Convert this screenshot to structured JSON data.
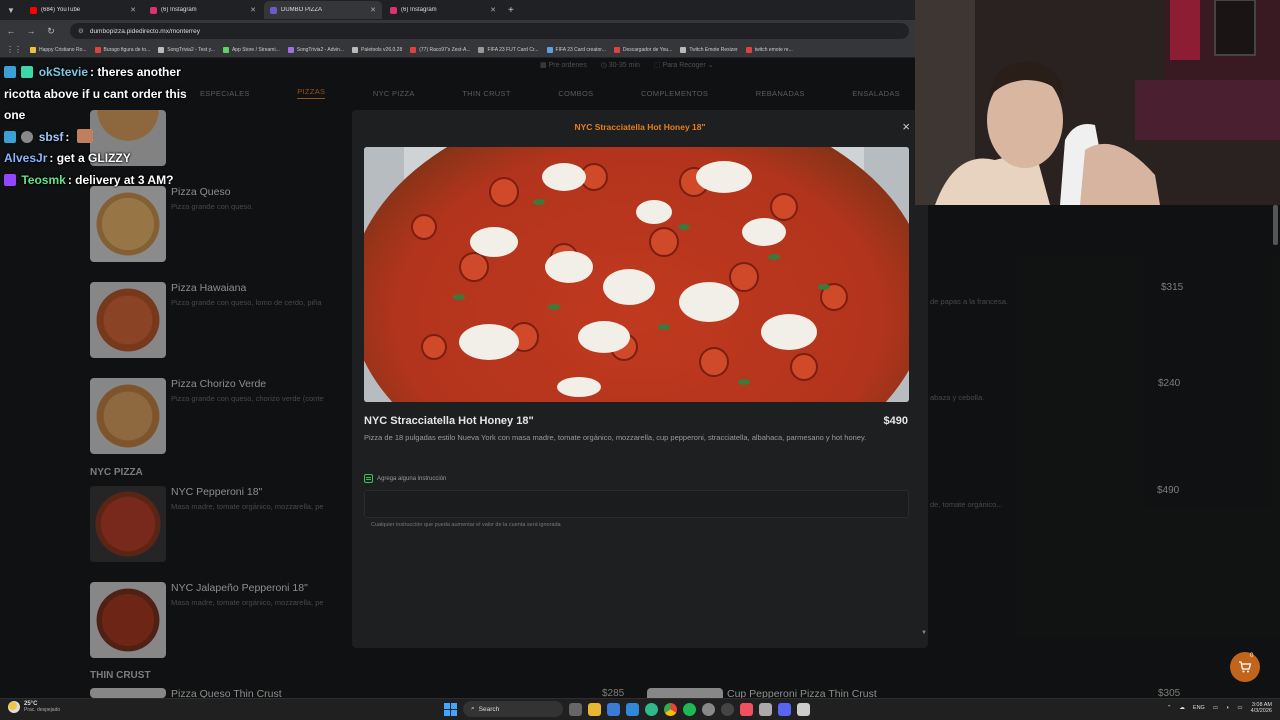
{
  "browser": {
    "tabs": [
      {
        "label": "(684) YouTube",
        "color": "#ff0000",
        "active": false
      },
      {
        "label": "(6) Instagram",
        "color": "#e1306c",
        "active": false
      },
      {
        "label": "DUMBO PIZZA",
        "color": "#6a5acd",
        "active": true
      },
      {
        "label": "(6) Instagram",
        "color": "#e1306c",
        "active": false
      }
    ],
    "url": "dumbopizza.pidedirecto.mx/monterrey",
    "bookmarks": [
      "Happy Cristiano Ro...",
      "Burago figura de to...",
      "SongTrivia2 - Test y...",
      "App Store / Streami...",
      "SongTrivia2 - Advin...",
      "Paletools v26.0.28",
      "(77) Raco97's Zest-A...",
      "FIFA 23 FUT Card Cr...",
      "FIFA 23 Card creator...",
      "Descargador de You...",
      "Twitch Emote Resizer",
      "twitch emote re..."
    ]
  },
  "page": {
    "subinfo": {
      "preorders": "Pre ordenes",
      "time": "30-35 min",
      "pickup": "Para Recoger"
    },
    "categories": [
      "ESPECIALES",
      "PIZZAS",
      "NYC PIZZA",
      "THIN CRUST",
      "COMBOS",
      "COMPLEMENTOS",
      "REBANADAS",
      "ENSALADAS"
    ],
    "active_category": "PIZZAS",
    "items": [
      {
        "name": "Pizza Queso",
        "desc": "Pizza grande con queso."
      },
      {
        "name": "Pizza Hawaiana",
        "desc": "Pizza grande con queso, lomo de cerdo, piña"
      },
      {
        "name": "Pizza Chorizo Verde",
        "desc": "Pizza grande con queso, chorizo verde (conte"
      },
      {
        "name": "NYC Pepperoni 18\"",
        "desc": "Masa madre, tomate orgánico, mozzarella, pe"
      },
      {
        "name": "NYC Jalapeño Pepperoni 18\"",
        "desc": "Masa madre, tomate orgánico, mozzarella, pe"
      },
      {
        "name": "Pizza Queso Thin Crust",
        "desc": ""
      }
    ],
    "sections": {
      "nyc": "NYC PIZZA",
      "thin": "THIN CRUST"
    },
    "right_column": {
      "prices": [
        "$315",
        "$240",
        "$490",
        "$305"
      ],
      "desc_fragments": [
        "de papas a la francesa.",
        "abaza y cebolla.",
        "de, tomate orgánico..."
      ],
      "bottom_item": "Cup Pepperoni Pizza Thin Crust",
      "bottom_left_price": "$285"
    }
  },
  "modal": {
    "title": "NYC Stracciatella Hot Honey 18\"",
    "product_name": "NYC Stracciatella Hot Honey 18\"",
    "price": "$490",
    "description": "Pizza de 18 pulgadas estilo Nueva York con masa madre, tomate orgánico, mozzarella, cup pepperoni, stracciatella, albahaca, parmesano y hot honey.",
    "instruction_label": "Agrega alguna instrucción",
    "instruction_note": "Cualquier instrucción que pueda aumentar el valor de la cuenta será ignorada",
    "close": "×"
  },
  "chat": [
    {
      "user": "okStevie",
      "color": "#7ec8e3",
      "msg": ": theres another ricotta above if u cant order this one"
    },
    {
      "user": "sbsf",
      "color": "#a3c8ff",
      "msg": ":"
    },
    {
      "user": "AlvesJr",
      "color": "#8ab4ff",
      "msg": ": get a GLIZZY"
    },
    {
      "user": "Teosmk",
      "color": "#66e08a",
      "msg": ": delivery at 3 AM?"
    }
  ],
  "cart": {
    "count": "0"
  },
  "taskbar": {
    "temp": "25°C",
    "weather": "Prac. despejado",
    "search": "Search",
    "lang": "ENG",
    "time": "3:08 AM",
    "date": "4/3/2026"
  },
  "colors": {
    "accent": "#e67e22",
    "page_bg": "#1a1b1c",
    "modal_bg": "#1e1f21"
  }
}
